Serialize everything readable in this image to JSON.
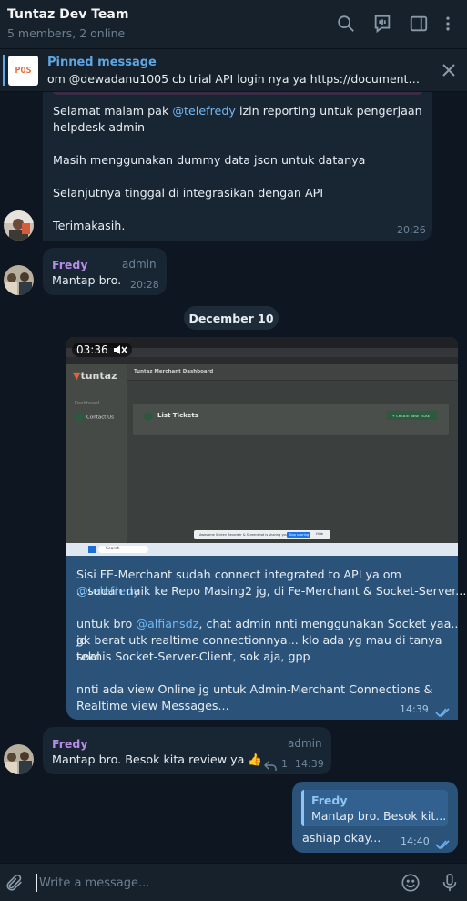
{
  "header": {
    "title": "Tuntaz Dev Team",
    "subtitle": "5 members, 2 online",
    "icons": [
      "search-icon",
      "video-chat-icon",
      "sidebar-toggle-icon",
      "more-vertical-icon"
    ]
  },
  "pinned": {
    "thumb_text": "POS",
    "title": "Pinned message",
    "text": "om @dewadanu1005 cb trial API login nya ya  https://documenter...."
  },
  "messages": {
    "m1": {
      "line1_pre": "Selamat malam pak ",
      "line1_mention": "@telefredy",
      "line1_post": "  izin reporting untuk pengerjaan",
      "line2": "helpdesk admin",
      "line3": "Masih menggunakan dummy data json untuk datanya",
      "line4": "Selanjutnya tinggal di integrasikan dengan API",
      "line5": "Terimakasih.",
      "time": "20:26"
    },
    "m2": {
      "sender": "Fredy",
      "role": "admin",
      "text": "Mantap bro.",
      "time": "20:28"
    },
    "date_separator": "December 10",
    "m3": {
      "video_duration": "03:36",
      "video_logo_brand": "tuntaz",
      "video_header": "Tuntaz Merchant Dashboard",
      "video_menu_dashboard": "Dashboard",
      "video_menu_contact": "Contact Us",
      "video_list_title": "List Tickets",
      "video_create_button": "+ CREATE NEW TICKET",
      "video_share_text": "Awesome Screen Recorder & Screenshot is sharing your screen.",
      "video_share_stop": "Stop sharing",
      "video_share_hide": "Hide",
      "video_search": "Search",
      "p1_pre": "Sisi FE-Merchant sudah connect integrated to API ya om ",
      "p1_mention": "@telefredy",
      "p1_line2": ".. sudah naik ke Repo Masing2 jg, di Fe-Merchant & Socket-Server...",
      "p2_pre": "untuk bro ",
      "p2_mention": "@alfiansdz",
      "p2_post": ", chat admin nnti menggunakan Socket yaa.. jd",
      "p2_line2": "gk berat utk realtime connectionnya... klo ada yg mau di tanya soal",
      "p2_line3": "teknis Socket-Server-Client, sok aja, gpp",
      "p3_line1": "nnti ada view Online jg untuk Admin-Merchant Connections &",
      "p3_line2": "Realtime view Messages...",
      "time": "14:39"
    },
    "m4": {
      "sender": "Fredy",
      "role": "admin",
      "text": "Mantap bro. Besok kita review ya 👍",
      "reply_count": "1",
      "time": "14:39"
    },
    "m5": {
      "quote_sender": "Fredy",
      "quote_text": "Mantap bro. Besok kit...",
      "text": "ashiap okay...",
      "time": "14:40"
    }
  },
  "composer": {
    "placeholder": "Write a message...",
    "icons": [
      "attach-icon",
      "emoji-icon",
      "microphone-icon"
    ]
  },
  "colors": {
    "background": "#0e1621",
    "header": "#17212b",
    "incoming_bubble": "#182533",
    "outgoing_bubble": "#2b5278",
    "accent": "#5ea6e4",
    "sender_name": "#b38ce4"
  }
}
